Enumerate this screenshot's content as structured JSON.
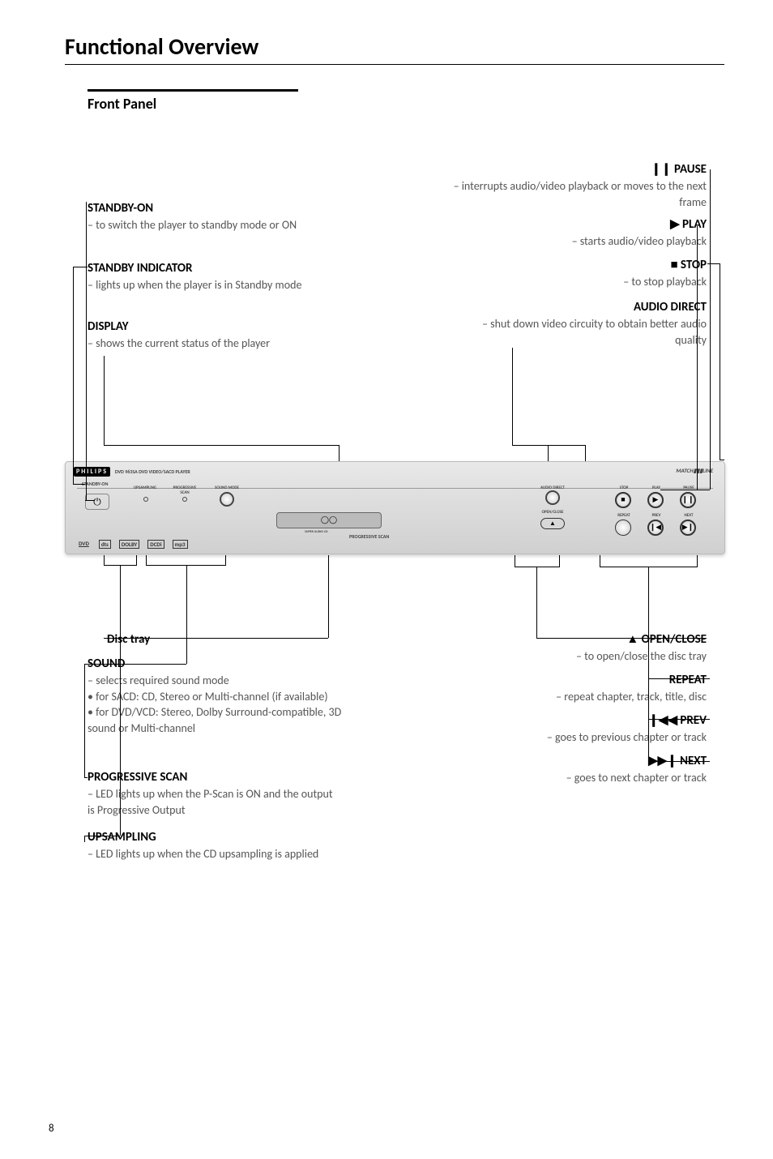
{
  "page": {
    "title": "Functional Overview",
    "section": "Front Panel",
    "number": "8"
  },
  "labels_left": {
    "standby_on": {
      "head": "STANDBY-ON",
      "desc": "– to switch the player to standby mode or ON"
    },
    "standby_indicator": {
      "head": "STANDBY INDICATOR",
      "desc": "– lights up when the player is in Standby mode"
    },
    "display": {
      "head": "DISPLAY",
      "desc": "– shows the current status of the player"
    },
    "disc_tray": {
      "head": "Disc tray"
    },
    "sound": {
      "head": "SOUND",
      "d1": "– selects required sound mode",
      "d2": "• for SACD: CD, Stereo or Multi-channel (if available)",
      "d3": "• for DVD/VCD: Stereo, Dolby Surround-compatible, 3D sound or Multi-channel"
    },
    "prog_scan": {
      "head": "PROGRESSIVE SCAN",
      "desc": "– LED lights up when the P-Scan is ON and the output is Progressive Output"
    },
    "upsampling": {
      "head": "UPSAMPLING",
      "desc": "– LED lights up when the CD upsampling is applied"
    }
  },
  "labels_right": {
    "pause": {
      "head": "❙❙ PAUSE",
      "desc": "– interrupts audio/video playback or moves to the next frame"
    },
    "play": {
      "head": "▶ PLAY",
      "desc": "– starts audio/video playback"
    },
    "stop": {
      "head": "■ STOP",
      "desc": "– to stop playback"
    },
    "audio_direct": {
      "head": "AUDIO DIRECT",
      "desc": "– shut down video circuity to obtain better audio quality"
    },
    "open_close": {
      "head": "▲ OPEN/CLOSE",
      "desc": "– to open/close the disc tray"
    },
    "repeat": {
      "head": "REPEAT",
      "desc": "– repeat chapter, track, title, disc"
    },
    "prev": {
      "head": "❙◀◀ PREV",
      "desc": "– goes to previous chapter or track"
    },
    "next": {
      "head": "▶▶❙ NEXT",
      "desc": "– goes to next chapter or track"
    }
  },
  "device": {
    "brand": "PHILIPS",
    "model": "DVD 963SA  DVD VIDEO/SACD PLAYER",
    "standby": "STANDBY-ON",
    "upsampling": "UPSAMPLING",
    "progscan": "PROGRESSIVE\nSCAN",
    "soundmode": "SOUND MODE",
    "progscan_text": "PROGRESSIVE SCAN",
    "audio_direct": "AUDIO DIRECT",
    "open_close": "OPEN/CLOSE",
    "stop": "STOP",
    "play": "PLAY",
    "pause": "PAUSE",
    "repeat": "REPEAT",
    "prev": "PREV",
    "next": "NEXT",
    "matchline": "MATCH▮▮▮LINE",
    "superaudio": "SUPER AUDIO CD",
    "logos": [
      "DVD",
      "dts",
      "DOLBY",
      "DCDi",
      "mp3"
    ]
  }
}
